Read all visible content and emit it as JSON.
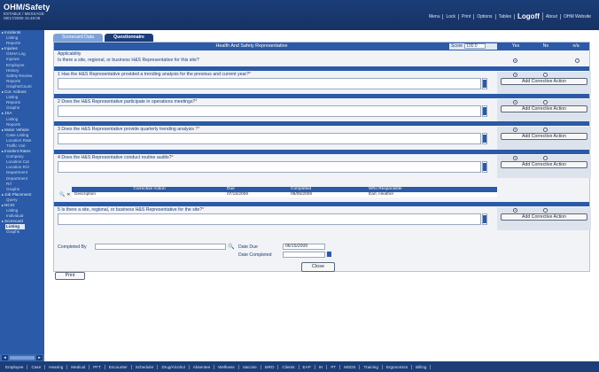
{
  "header": {
    "app_title": "OHM/Safety",
    "subtitle_line1": "ESTABLE / MESSAGE",
    "subtitle_line2": "08/17/2009 15:49:08",
    "menu": [
      "Menu",
      "Lock",
      "Print",
      "Options",
      "Tables"
    ],
    "logoff": "Logoff",
    "menu_after": [
      "About",
      "OHM Website"
    ]
  },
  "sidebar": {
    "items": [
      {
        "label": "Incidents",
        "kind": "cat"
      },
      {
        "label": "Listing",
        "kind": "sub"
      },
      {
        "label": "Reports",
        "kind": "sub"
      },
      {
        "label": "Injuries",
        "kind": "cat"
      },
      {
        "label": "OSHA Log",
        "kind": "sub"
      },
      {
        "label": "Injuries",
        "kind": "sub"
      },
      {
        "label": "Employee",
        "kind": "sub"
      },
      {
        "label": "History",
        "kind": "sub"
      },
      {
        "label": "Safety Review",
        "kind": "sub"
      },
      {
        "label": "Reports",
        "kind": "sub"
      },
      {
        "label": "Graphs/Count",
        "kind": "sub"
      },
      {
        "label": "Cor. Actions",
        "kind": "cat"
      },
      {
        "label": "Listing",
        "kind": "sub"
      },
      {
        "label": "Reports",
        "kind": "sub"
      },
      {
        "label": "Graphs",
        "kind": "sub"
      },
      {
        "label": "JSA",
        "kind": "cat"
      },
      {
        "label": "Listing",
        "kind": "sub"
      },
      {
        "label": "Reports",
        "kind": "sub"
      },
      {
        "label": "Motor Vehicle",
        "kind": "cat"
      },
      {
        "label": "Case Listing",
        "kind": "sub"
      },
      {
        "label": "Location Rate",
        "kind": "sub"
      },
      {
        "label": "Traffic Viol",
        "kind": "sub"
      },
      {
        "label": "Incident Rates",
        "kind": "cat"
      },
      {
        "label": "Company",
        "kind": "sub"
      },
      {
        "label": "Location Cat",
        "kind": "sub"
      },
      {
        "label": "Location R/A",
        "kind": "sub"
      },
      {
        "label": "Department",
        "kind": "sub"
      },
      {
        "label": "Department",
        "kind": "sub"
      },
      {
        "label": "R/I",
        "kind": "sub"
      },
      {
        "label": "Graphs",
        "kind": "sub"
      },
      {
        "label": "Job Placement",
        "kind": "cat"
      },
      {
        "label": "Query",
        "kind": "sub"
      },
      {
        "label": "NCIO",
        "kind": "cat"
      },
      {
        "label": "Listing",
        "kind": "sub"
      },
      {
        "label": "Individual",
        "kind": "sub"
      },
      {
        "label": "Scorecard",
        "kind": "cat"
      },
      {
        "label": "Listing",
        "kind": "sel"
      },
      {
        "label": "Graphs",
        "kind": "sub"
      }
    ]
  },
  "tabs": [
    {
      "label": "Scorecard Data",
      "active": false
    },
    {
      "label": "Questionnaire",
      "active": true
    }
  ],
  "panel": {
    "title": "Health And Safety Representative",
    "score_label": "Score",
    "score_value": "100.0",
    "col_yes": "Yes",
    "col_no": "No",
    "col_na": "n/a",
    "applicability_label": "Applicability",
    "applicability_question": "Is there a site, regional, or business H&S Representative for this site?",
    "add_ca_label": "Add Corrective Action",
    "questions": [
      {
        "text": "1 Has the H&S Representative provided a trending analysis for the previous and current year?",
        "req": "*",
        "answer": "yes"
      },
      {
        "text": "2 Does the H&S Representative participate in operations meetings?",
        "req": "*",
        "answer": "yes"
      },
      {
        "text": "3 Does the H&S Representative provide quarterly trending analysis ",
        "req": "?*",
        "answer": "yes"
      },
      {
        "text": "4 Does the H&S Representative conduct routine audits?",
        "req": "*",
        "answer": "yes"
      },
      {
        "text": "5 Is there a site, regional, or business H&S Representative for the site?",
        "req": "*",
        "answer": "yes"
      }
    ],
    "ca_table": {
      "headers": [
        "Corrective Action",
        "Due",
        "Completed",
        "Who Responsible"
      ],
      "rows": [
        [
          "Description",
          "07/15/2009",
          "08/05/2009",
          "Earl, Heather"
        ]
      ]
    }
  },
  "footer": {
    "completed_by_label": "Completed By",
    "completed_by_value": "",
    "date_due_label": "Date Due",
    "date_due_value": "06/15/2009",
    "date_completed_label": "Date Completed",
    "date_completed_value": "",
    "print_label": "Print",
    "close_label": "Close"
  },
  "bottom_tabs": [
    "Employee",
    "Case",
    "Hearing",
    "Medical",
    "PFT",
    "Encounter",
    "Scheduler",
    "Drug/Alcohol",
    "Absentee",
    "Wellness",
    "Vaccine",
    "MRO",
    "Clients",
    "EAP",
    "IH",
    "PT",
    "MSDS",
    "Training",
    "Ergonomics",
    "Billing"
  ],
  "bottom_active": "Safety",
  "colors": {
    "brand": "#1b3d78",
    "accent": "#2a5aa8",
    "required": "#c0392b"
  }
}
